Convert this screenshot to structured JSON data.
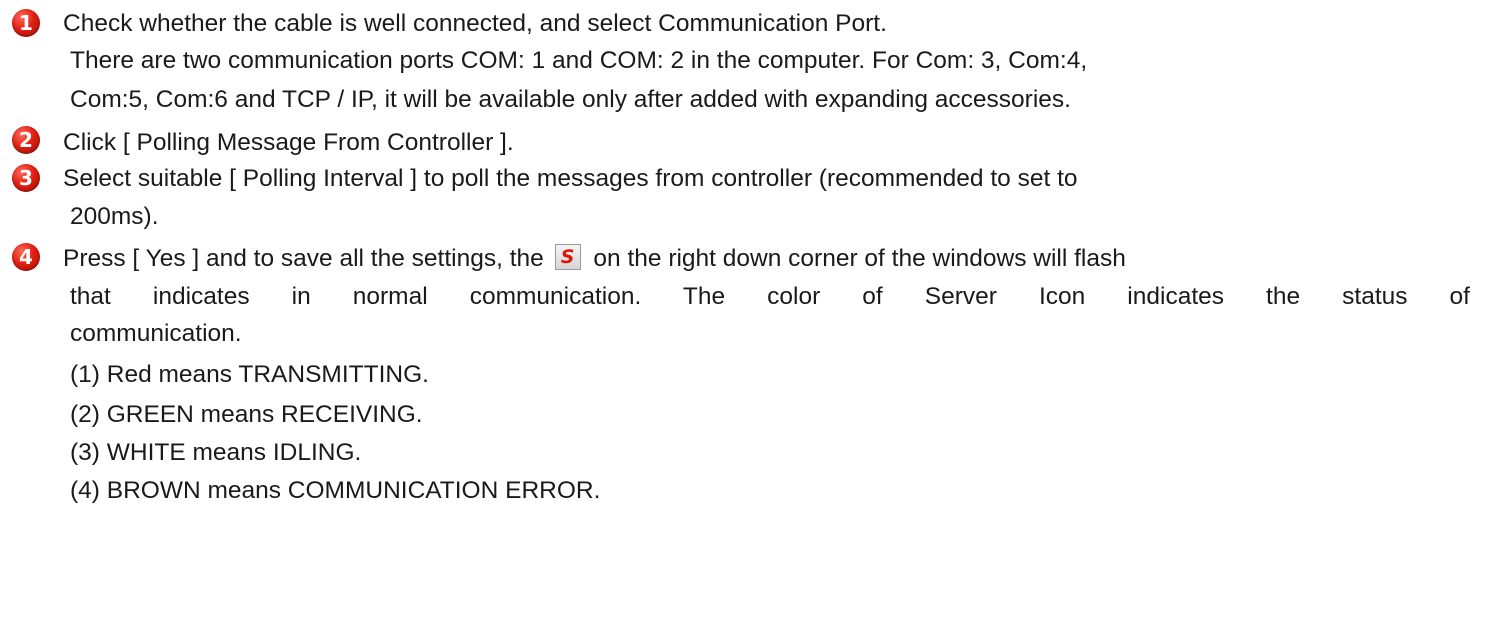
{
  "steps": [
    {
      "number": "1",
      "title": "Check whether the cable is well connected, and select Communication Port.",
      "details": [
        "There are two communication ports COM: 1 and COM: 2 in the computer. For Com: 3, Com:4,",
        "Com:5, Com:6 and TCP / IP, it will be available only after added with expanding accessories."
      ]
    },
    {
      "number": "2",
      "title": "Click [ Polling Message From Controller ]."
    },
    {
      "number": "3",
      "title": "Select suitable [ Polling Interval ] to poll the messages from controller (recommended to set to",
      "details": [
        "200ms)."
      ]
    },
    {
      "number": "4",
      "title_before_icon": "Press [ Yes ] and to save all the settings, the",
      "icon_name": "server-icon",
      "icon_letter": "S",
      "title_after_icon": "on the right down corner of the windows will flash",
      "details": [
        "that indicates in normal communication. The color of Server Icon indicates the status of",
        "communication."
      ],
      "status_list": [
        "(1) Red means TRANSMITTING.",
        "(2) GREEN means RECEIVING.",
        "(3) WHITE means IDLING.",
        "(4) BROWN means COMMUNICATION ERROR."
      ]
    }
  ]
}
